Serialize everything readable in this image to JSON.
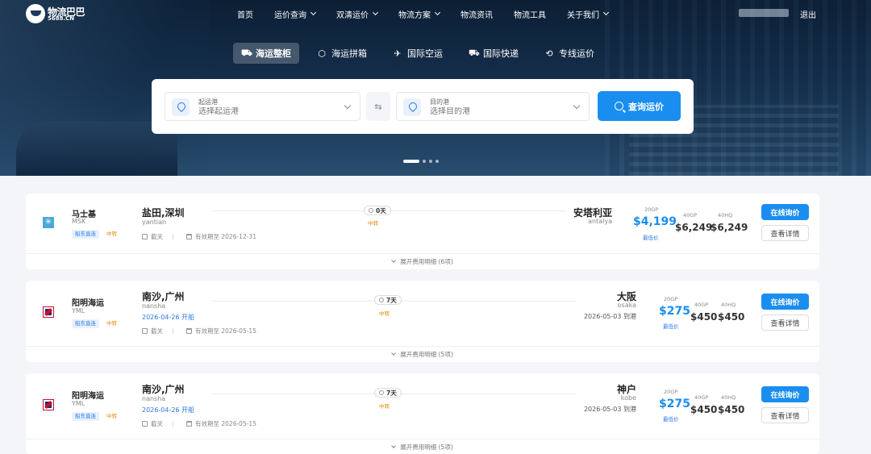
{
  "nav": {
    "logo_text": "物流巴巴",
    "logo_sub": "5688.CN",
    "menu": [
      {
        "label": "首页",
        "caret": false
      },
      {
        "label": "运价查询",
        "caret": true
      },
      {
        "label": "双清运价",
        "caret": true
      },
      {
        "label": "物流方案",
        "caret": true
      },
      {
        "label": "物流资讯",
        "caret": false
      },
      {
        "label": "物流工具",
        "caret": false
      },
      {
        "label": "关于我们",
        "caret": true
      }
    ],
    "logout": "退出"
  },
  "tabs": [
    {
      "label": "海运整柜",
      "icon": "container-icon",
      "glyph": "⛟",
      "active": true
    },
    {
      "label": "海运拼箱",
      "icon": "box-icon",
      "glyph": "⬡",
      "active": false
    },
    {
      "label": "国际空运",
      "icon": "plane-icon",
      "glyph": "✈",
      "active": false
    },
    {
      "label": "国际快递",
      "icon": "truck-icon",
      "glyph": "⛟",
      "active": false
    },
    {
      "label": "专线运价",
      "icon": "route-icon",
      "glyph": "⟲",
      "active": false
    }
  ],
  "search": {
    "origin_label": "起运港",
    "origin_placeholder": "选择起运港",
    "dest_label": "目的港",
    "dest_placeholder": "选择目的港",
    "swap_glyph": "⇆",
    "query_label": "查询运价"
  },
  "colors": {
    "primary": "#1a8ef0",
    "warning": "#e08a00",
    "yml_red": "#c8102e",
    "msk_blue": "#4aa9d8"
  },
  "results": [
    {
      "carrier": "马士基",
      "carrier_code": "MSK",
      "logo": "msk-star-icon",
      "badge_direct": "船东直连",
      "badge_transfer": "中转",
      "pol": "盐田,深圳",
      "pol_en": "yantian",
      "sailing": "",
      "cutoff": "截关",
      "valid": "有效期至 2026-12-31",
      "transit": "0天",
      "transfer_tag": "中转",
      "pod": "安塔利亚",
      "pod_en": "antalya",
      "arrival": "",
      "c20": "20GP",
      "p20": "$4,199",
      "lowest": "最低价",
      "c40": "40GP",
      "p40": "$6,249",
      "c40hq": "40HQ",
      "p40hq": "$6,249",
      "inquiry": "在线询价",
      "detail": "查看详情",
      "expand": "展开费用明细 (6项)"
    },
    {
      "carrier": "阳明海运",
      "carrier_code": "YML",
      "logo": "yml-logo-icon",
      "badge_direct": "船东直连",
      "badge_transfer": "中转",
      "pol": "南沙,广州",
      "pol_en": "nansha",
      "sailing": "2026-04-26 开船",
      "cutoff": "截关",
      "valid": "有效期至 2026-05-15",
      "transit": "7天",
      "transfer_tag": "中转",
      "pod": "大阪",
      "pod_en": "osaka",
      "arrival": "2026-05-03 到港",
      "c20": "20GP",
      "p20": "$275",
      "lowest": "最低价",
      "c40": "40GP",
      "p40": "$450",
      "c40hq": "40HQ",
      "p40hq": "$450",
      "inquiry": "在线询价",
      "detail": "查看详情",
      "expand": "展开费用明细 (5项)"
    },
    {
      "carrier": "阳明海运",
      "carrier_code": "YML",
      "logo": "yml-logo-icon",
      "badge_direct": "船东直连",
      "badge_transfer": "中转",
      "pol": "南沙,广州",
      "pol_en": "nansha",
      "sailing": "2026-04-26 开船",
      "cutoff": "截关",
      "valid": "有效期至 2026-05-15",
      "transit": "7天",
      "transfer_tag": "中转",
      "pod": "神户",
      "pod_en": "kobe",
      "arrival": "2026-05-03 到港",
      "c20": "20GP",
      "p20": "$275",
      "lowest": "最低价",
      "c40": "40GP",
      "p40": "$450",
      "c40hq": "40HQ",
      "p40hq": "$450",
      "inquiry": "在线询价",
      "detail": "查看详情",
      "expand": "展开费用明细 (5项)"
    }
  ]
}
